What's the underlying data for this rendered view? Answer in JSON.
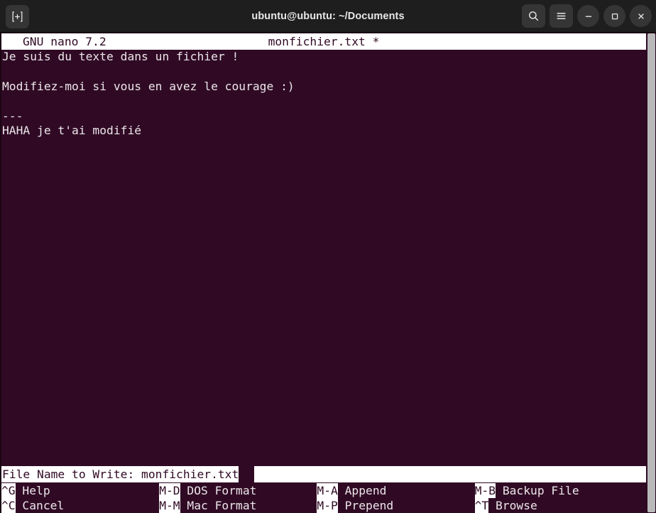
{
  "window": {
    "title": "ubuntu@ubuntu: ~/Documents",
    "new_tab_icon": "new-tab-icon",
    "search_icon": "search-icon",
    "menu_icon": "hamburger-menu-icon",
    "minimize_icon": "minimize-icon",
    "maximize_icon": "maximize-icon",
    "close_icon": "close-icon"
  },
  "colors": {
    "titlebar_bg": "#1e1e1e",
    "terminal_bg": "#300a24",
    "terminal_fg": "#ece6ea",
    "inverted_bg": "#ffffff",
    "inverted_fg": "#300a24",
    "scrollbar": "#b9b9b9"
  },
  "editor": {
    "version": "GNU nano 7.2",
    "filename": "monfichier.txt *",
    "content_lines": [
      "Je suis du texte dans un fichier !",
      "",
      "Modifiez-moi si vous en avez le courage :)",
      "",
      "---",
      "HAHA je t'ai modifié"
    ]
  },
  "prompt": {
    "label": "File Name to Write:",
    "value": "monfichier.txt",
    "full_text": "File Name to Write: monfichier.txt"
  },
  "shortcuts": {
    "row1": [
      {
        "key": "^G",
        "label": "Help"
      },
      {
        "key": "M-D",
        "label": "DOS Format"
      },
      {
        "key": "M-A",
        "label": "Append"
      },
      {
        "key": "M-B",
        "label": "Backup File"
      }
    ],
    "row2": [
      {
        "key": "^C",
        "label": "Cancel"
      },
      {
        "key": "M-M",
        "label": "Mac Format"
      },
      {
        "key": "M-P",
        "label": "Prepend"
      },
      {
        "key": "^T",
        "label": "Browse"
      }
    ]
  }
}
